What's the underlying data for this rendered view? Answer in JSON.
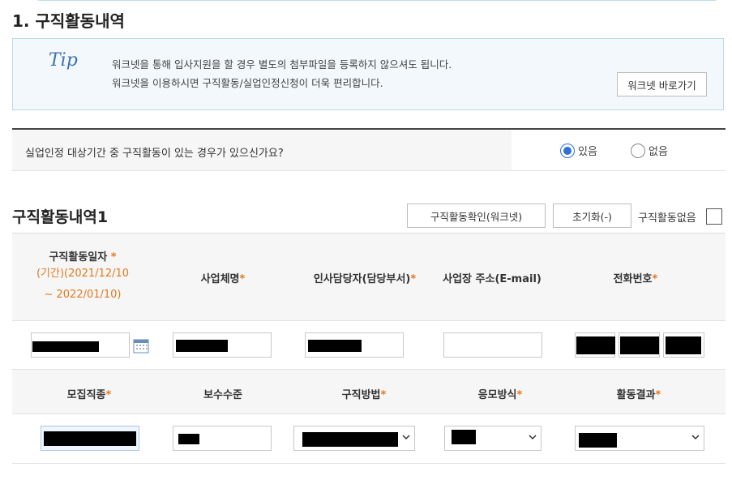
{
  "section": {
    "title": "1. 구직활동내역"
  },
  "tip": {
    "logo": "Tip",
    "line1": "워크넷을 통해 입사지원을 할 경우 별도의 첨부파일을 등록하지 않으셔도 됩니다.",
    "line2": "워크넷을 이용하시면 구직활동/실업인정신청이 더욱 편리합니다.",
    "button": "워크넷 바로가기"
  },
  "question": {
    "text": "실업인정 대상기간 중 구직활동이 있는 경우가 있으신가요?",
    "options": [
      {
        "label": "있음",
        "checked": true
      },
      {
        "label": "없음",
        "checked": false
      }
    ]
  },
  "activity": {
    "title": "구직활동내역1",
    "confirm_button": "구직활동확인(워크넷)",
    "reset_button": "초기화(-)",
    "none_label": "구직활동없음",
    "none_checked": false
  },
  "header1": {
    "date": "구직활동일자",
    "star": "*",
    "period_line1": "(기간)(2021/12/10",
    "period_line2": "~ 2022/01/10)",
    "company": "사업체명",
    "hr": "인사담당자(담당부서)",
    "address": "사업장 주소(E-mail)",
    "phone": "전화번호"
  },
  "header2": {
    "job_type": "모집직종",
    "salary": "보수수준",
    "method": "구직방법",
    "apply": "응모방식",
    "result": "활동결과"
  },
  "icons": {
    "calendar": "calendar-icon",
    "dropdown": "chevron-down-icon",
    "accent": "#e4781f",
    "radio": "#2f6fd6"
  }
}
